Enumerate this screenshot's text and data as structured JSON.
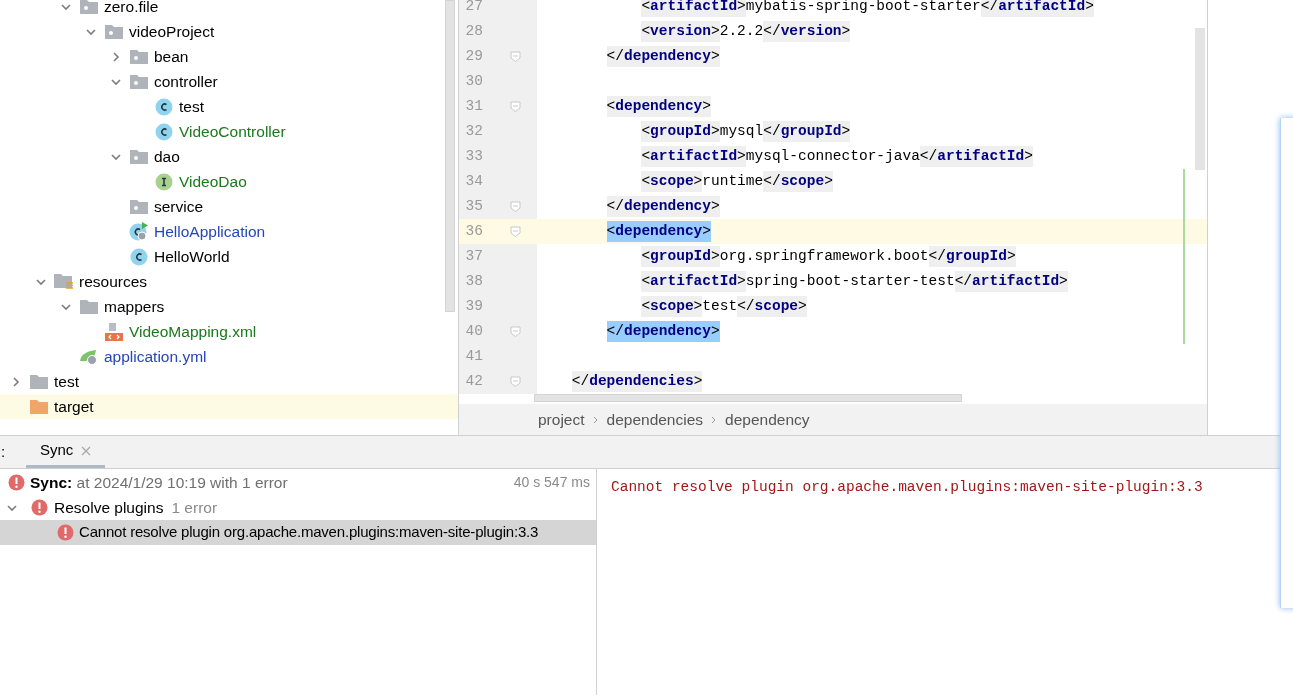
{
  "project_tree": {
    "items": [
      {
        "children": [
          {
            "children": [
              {
                "label": "zero.file",
                "kind": "package",
                "expanded": true,
                "children": [
                  {
                    "label": "videoProject",
                    "kind": "package",
                    "expanded": true,
                    "children": [
                      {
                        "label": "bean",
                        "kind": "package",
                        "expanded": false
                      },
                      {
                        "label": "controller",
                        "kind": "package",
                        "expanded": true,
                        "children": [
                          {
                            "label": "test",
                            "kind": "class"
                          },
                          {
                            "label": "VideoController",
                            "kind": "class",
                            "color": "#197a19"
                          }
                        ]
                      },
                      {
                        "label": "dao",
                        "kind": "package",
                        "expanded": true,
                        "children": [
                          {
                            "label": "VideoDao",
                            "kind": "interface",
                            "color": "#197a19"
                          }
                        ]
                      },
                      {
                        "label": "service",
                        "kind": "package"
                      },
                      {
                        "label": "HelloApplication",
                        "kind": "app",
                        "color": "#2446b8"
                      },
                      {
                        "label": "HelloWorld",
                        "kind": "class"
                      }
                    ]
                  }
                ]
              }
            ]
          },
          {
            "label": "resources",
            "kind": "resources",
            "expanded": true,
            "children": [
              {
                "label": "mappers",
                "kind": "folder",
                "expanded": true,
                "children": [
                  {
                    "label": "VideoMapping.xml",
                    "kind": "xml",
                    "color": "#197a19"
                  }
                ]
              },
              {
                "label": "application.yml",
                "kind": "yml",
                "color": "#2446b8"
              }
            ]
          }
        ]
      },
      {
        "label": "test",
        "kind": "folder",
        "expanded": false
      },
      {
        "label": "target",
        "kind": "excluded",
        "highlighted": true
      }
    ]
  },
  "editor": {
    "lines": [
      {
        "number": "27",
        "tokens": [
          {
            "kind": "tag",
            "text": "<artifactId>"
          },
          {
            "kind": "text",
            "text": "mybatis-spring-boot-starter"
          },
          {
            "kind": "tag",
            "text": "</artifactId>"
          }
        ]
      },
      {
        "number": "28",
        "tokens": [
          {
            "kind": "tag",
            "text": "<version>"
          },
          {
            "kind": "text",
            "text": "2.2.2"
          },
          {
            "kind": "tag",
            "text": "</version>"
          }
        ]
      },
      {
        "number": "29",
        "fold": true,
        "tokens": [
          {
            "kind": "tag",
            "text": "</dependency>"
          }
        ]
      },
      {
        "number": "30"
      },
      {
        "number": "31",
        "fold": true,
        "tokens": [
          {
            "kind": "tag",
            "text": "<dependency>"
          }
        ]
      },
      {
        "number": "32",
        "tokens": [
          {
            "kind": "tag",
            "text": "<groupId>"
          },
          {
            "kind": "text",
            "text": "mysql"
          },
          {
            "kind": "tag",
            "text": "</groupId>"
          }
        ]
      },
      {
        "number": "33",
        "tokens": [
          {
            "kind": "tag",
            "text": "<artifactId>"
          },
          {
            "kind": "text",
            "text": "mysql-connector-java"
          },
          {
            "kind": "tag",
            "text": "</artifactId>"
          }
        ]
      },
      {
        "number": "34",
        "changed": true,
        "tokens": [
          {
            "kind": "tag",
            "text": "<scope>"
          },
          {
            "kind": "text",
            "text": "runtime"
          },
          {
            "kind": "tag",
            "text": "</scope>"
          }
        ]
      },
      {
        "number": "35",
        "fold": true,
        "changed": true,
        "tokens": [
          {
            "kind": "tag",
            "text": "</dependency>"
          }
        ]
      },
      {
        "number": "36",
        "fold": true,
        "current": true,
        "changed": true,
        "tokens": [
          {
            "kind": "tag",
            "text": "<dependency>",
            "matched": true
          }
        ]
      },
      {
        "number": "37",
        "changed": true,
        "tokens": [
          {
            "kind": "tag",
            "text": "<groupId>"
          },
          {
            "kind": "text",
            "text": "org.springframework.boot"
          },
          {
            "kind": "tag",
            "text": "</groupId>"
          }
        ]
      },
      {
        "number": "38",
        "changed": true,
        "tokens": [
          {
            "kind": "tag",
            "text": "<artifactId>"
          },
          {
            "kind": "text",
            "text": "spring-boot-starter-test"
          },
          {
            "kind": "tag",
            "text": "</artifactId>"
          }
        ]
      },
      {
        "number": "39",
        "changed": true,
        "tokens": [
          {
            "kind": "tag",
            "text": "<scope>"
          },
          {
            "kind": "text",
            "text": "test"
          },
          {
            "kind": "tag",
            "text": "</scope>"
          }
        ]
      },
      {
        "number": "40",
        "fold": true,
        "changed": true,
        "tokens": [
          {
            "kind": "tag",
            "text": "</dependency>",
            "matched": true
          }
        ]
      },
      {
        "number": "41"
      },
      {
        "number": "42",
        "fold": true,
        "tokens": [
          {
            "kind": "tag",
            "text": "</dependencies>"
          }
        ]
      }
    ],
    "breadcrumbs": [
      "project",
      "dependencies",
      "dependency"
    ]
  },
  "build_panel": {
    "label": ":",
    "tabs": [
      {
        "label": "Sync",
        "selected": true
      }
    ],
    "tree": [
      {
        "kind": "summary",
        "title": "Sync:",
        "text": "at 2024/1/29 10:19 with 1 error",
        "time": "40 s 547 ms",
        "selected": false
      },
      {
        "kind": "group",
        "title": "Resolve plugins",
        "text": "1 error",
        "expanded": true,
        "selected": false
      },
      {
        "kind": "error",
        "title": "Cannot resolve plugin org.apache.maven.plugins:maven-site-plugin:3.3",
        "selected": true
      }
    ],
    "console": "Cannot resolve plugin org.apache.maven.plugins:maven-site-plugin:3.3"
  }
}
